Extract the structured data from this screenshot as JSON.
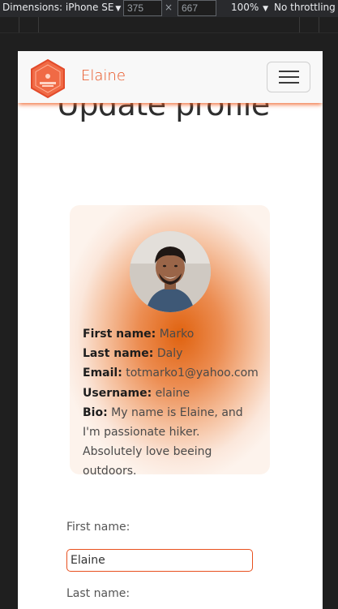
{
  "devtools": {
    "dimensions_label": "Dimensions: iPhone SE",
    "width": "375",
    "height": "667",
    "times": "×",
    "zoom": "100%",
    "throttling": "No throttling"
  },
  "navbar": {
    "brand": "Elaine",
    "logo_icon": "hexagon-logo-icon",
    "menu_icon": "hamburger-menu-icon"
  },
  "page": {
    "title": "Update profile"
  },
  "profile": {
    "first_name_label": "First name:",
    "first_name": "Marko",
    "last_name_label": "Last name:",
    "last_name": "Daly",
    "email_label": "Email:",
    "email": "totmarko1@yahoo.com",
    "username_label": "Username:",
    "username": "elaine",
    "bio_label": "Bio:",
    "bio": "My name is Elaine, and I'm passionate hiker. Absolutely love beeing outdoors."
  },
  "form": {
    "first_name_label": "First name:",
    "first_name_value": "Elaine",
    "last_name_label": "Last name:"
  },
  "colors": {
    "accent": "#e8501e",
    "navbar_bg": "#f8f8f8"
  }
}
